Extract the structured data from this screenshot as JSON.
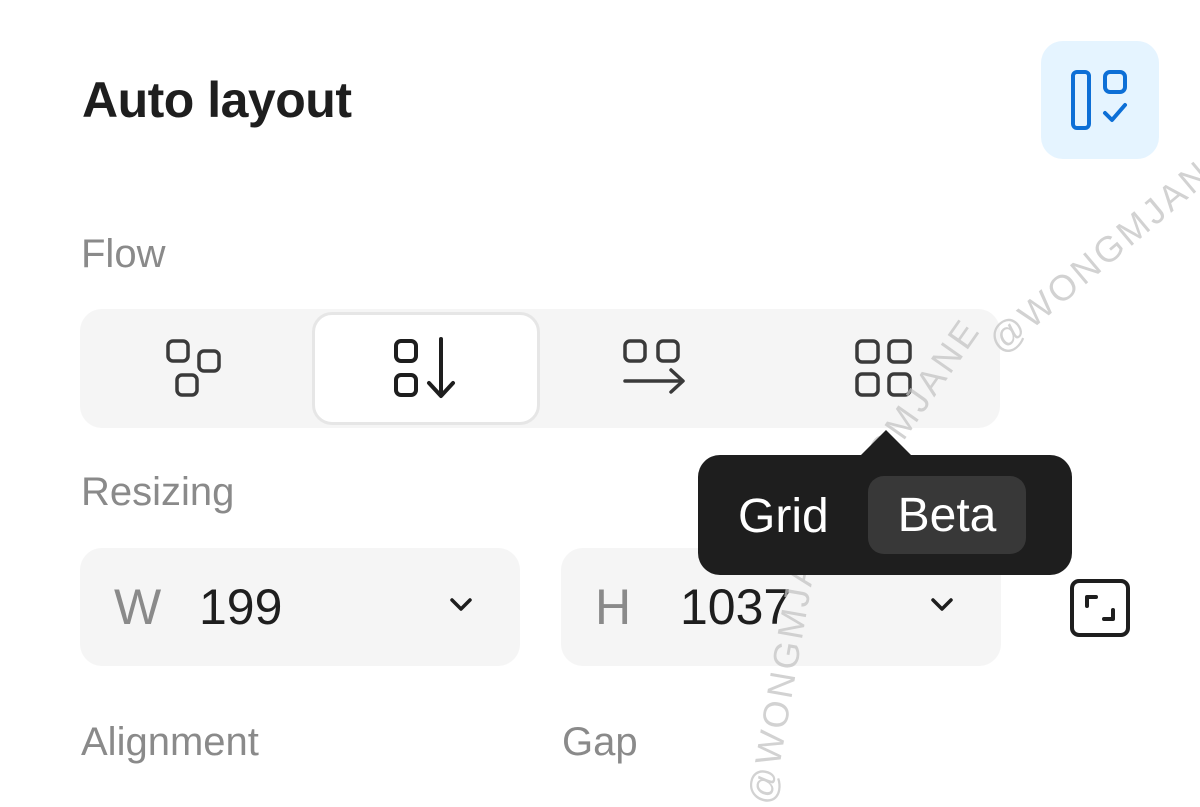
{
  "panel": {
    "title": "Auto layout"
  },
  "flow": {
    "label": "Flow",
    "options": [
      {
        "name": "freeform",
        "icon": "freeform-layout-icon",
        "selected": false
      },
      {
        "name": "vertical",
        "icon": "vertical-layout-icon",
        "selected": true
      },
      {
        "name": "horizontal",
        "icon": "horizontal-layout-icon",
        "selected": false
      },
      {
        "name": "grid",
        "icon": "grid-layout-icon",
        "selected": false
      }
    ]
  },
  "tooltip": {
    "text": "Grid",
    "badge": "Beta"
  },
  "resizing": {
    "label": "Resizing",
    "width": {
      "key": "W",
      "value": "199"
    },
    "height": {
      "key": "H",
      "value": "1037"
    }
  },
  "alignment": {
    "label": "Alignment"
  },
  "gap": {
    "label": "Gap"
  },
  "watermark": "@WONGMJANE",
  "colors": {
    "accent": "#0d6fd6",
    "accent_bg": "#e5f4ff",
    "tooltip_bg": "#1e1e1e",
    "badge_bg": "#383838",
    "field_bg": "#f5f5f5",
    "label": "#8a8a8a"
  }
}
